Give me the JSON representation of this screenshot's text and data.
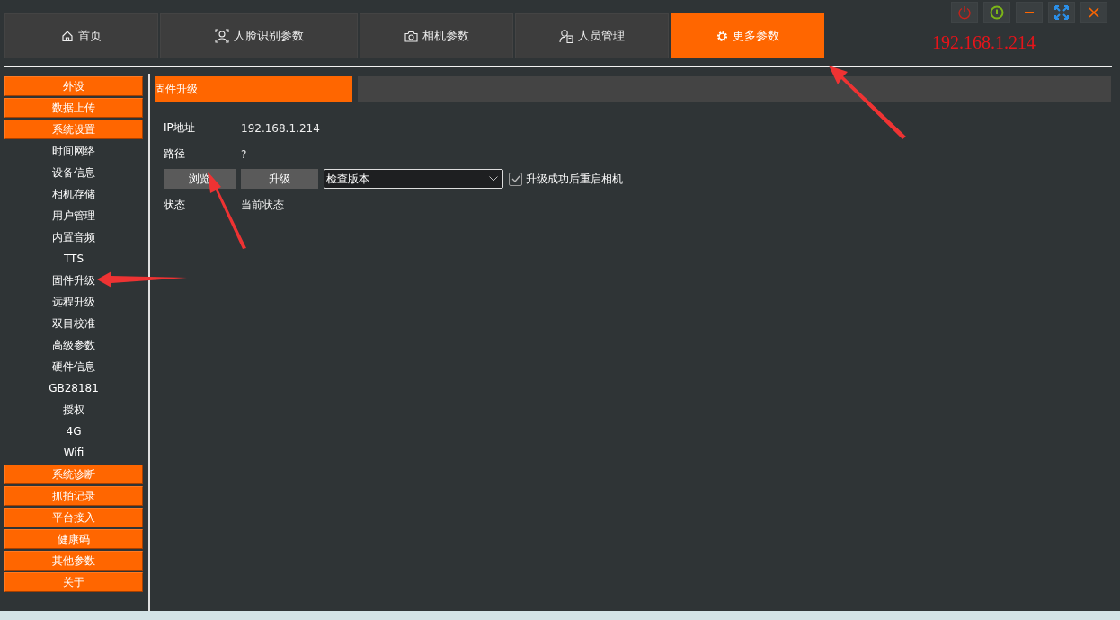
{
  "tabs": [
    {
      "label": "首页",
      "selected": false
    },
    {
      "label": "人脸识别参数",
      "selected": false
    },
    {
      "label": "相机参数",
      "selected": false
    },
    {
      "label": "人员管理",
      "selected": false
    },
    {
      "label": "更多参数",
      "selected": true
    }
  ],
  "device_ip": "192.168.1.214",
  "sidebar": {
    "items": [
      {
        "label": "外设",
        "kind": "header"
      },
      {
        "label": "数据上传",
        "kind": "header"
      },
      {
        "label": "系统设置",
        "kind": "header"
      },
      {
        "label": "时间网络",
        "kind": "item"
      },
      {
        "label": "设备信息",
        "kind": "item"
      },
      {
        "label": "相机存储",
        "kind": "item"
      },
      {
        "label": "用户管理",
        "kind": "item"
      },
      {
        "label": "内置音频",
        "kind": "item"
      },
      {
        "label": "TTS",
        "kind": "item"
      },
      {
        "label": "固件升级",
        "kind": "item"
      },
      {
        "label": "远程升级",
        "kind": "item"
      },
      {
        "label": "双目校准",
        "kind": "item"
      },
      {
        "label": "高级参数",
        "kind": "item"
      },
      {
        "label": "硬件信息",
        "kind": "item"
      },
      {
        "label": "GB28181",
        "kind": "item"
      },
      {
        "label": "授权",
        "kind": "item"
      },
      {
        "label": "4G",
        "kind": "item"
      },
      {
        "label": "Wifi",
        "kind": "item"
      },
      {
        "label": "系统诊断",
        "kind": "header"
      },
      {
        "label": "抓拍记录",
        "kind": "header"
      },
      {
        "label": "平台接入",
        "kind": "header"
      },
      {
        "label": "健康码",
        "kind": "header"
      },
      {
        "label": "其他参数",
        "kind": "header"
      },
      {
        "label": "关于",
        "kind": "header"
      }
    ]
  },
  "panel": {
    "title": "固件升级",
    "ip": {
      "label": "IP地址",
      "value": "192.168.1.214"
    },
    "path": {
      "label": "路径",
      "value": "?"
    },
    "browse_button": "浏览",
    "upgrade_button": "升级",
    "version_select": {
      "value": "检查版本"
    },
    "restart_checkbox": {
      "label": "升级成功后重启相机",
      "checked": true
    },
    "status": {
      "label": "状态",
      "value": "当前状态"
    }
  }
}
